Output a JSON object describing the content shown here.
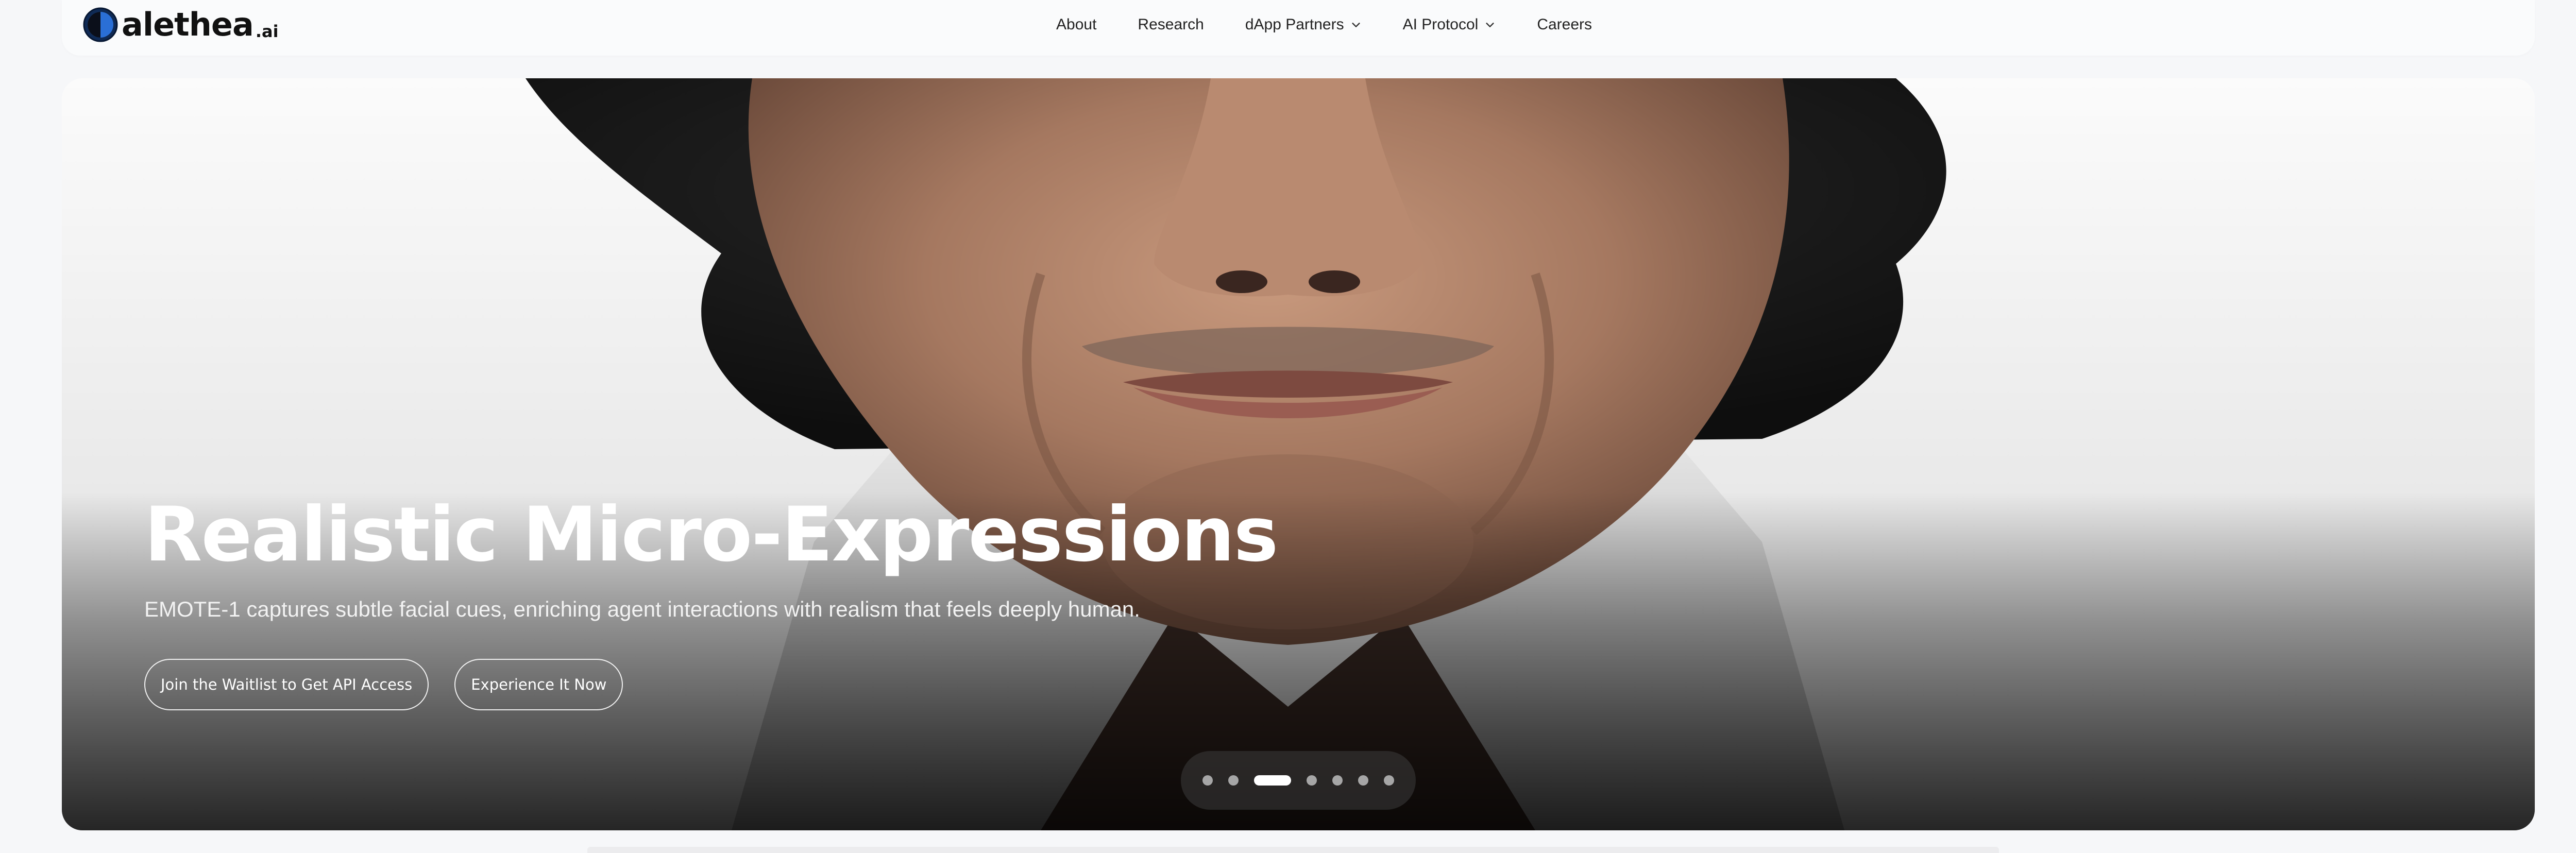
{
  "brand": {
    "name": "alethea",
    "tld": ".ai"
  },
  "nav": {
    "items": [
      {
        "label": "About"
      },
      {
        "label": "Research"
      },
      {
        "label": "dApp Partners",
        "dropdown": true
      },
      {
        "label": "AI Protocol",
        "dropdown": true
      },
      {
        "label": "Careers"
      }
    ]
  },
  "hero": {
    "title": "Realistic Micro-Expressions",
    "subtitle": "EMOTE-1 captures subtle facial cues, enriching agent interactions with realism that feels deeply human.",
    "cta_primary": "Join the Waitlist to Get API Access",
    "cta_secondary": "Experience It Now",
    "carousel": {
      "total_slides": 7,
      "active_slide": 3
    }
  },
  "colors": {
    "page_background": "#f6f7f9",
    "nav_background": "#fafbfc",
    "hero_text": "#ffffff",
    "active_dot": "#ffffff",
    "inactive_dot": "#a6a6a6"
  },
  "icons": [
    "alethea-logo-icon",
    "chevron-down-icon"
  ]
}
